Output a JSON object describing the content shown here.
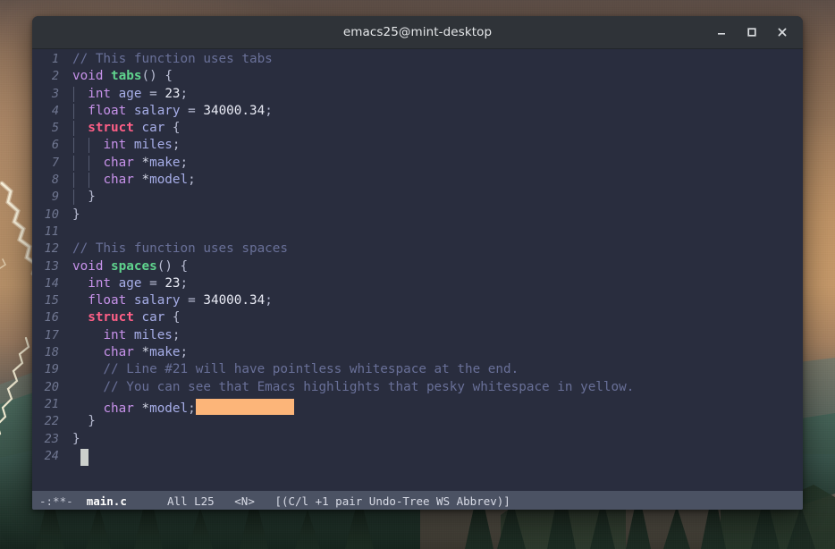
{
  "window": {
    "title": "emacs25@mint-desktop",
    "controls": [
      {
        "name": "minimize",
        "label": "Minimize",
        "glyph": "minimize-icon"
      },
      {
        "name": "maximize",
        "label": "Maximize",
        "glyph": "maximize-icon"
      },
      {
        "name": "close",
        "label": "Close",
        "glyph": "close-icon"
      }
    ]
  },
  "editor": {
    "buffer_name": "main.c",
    "cursor_line": 24,
    "cursor_column": 1,
    "lines": [
      {
        "n": 1,
        "text": "// This function uses tabs",
        "indent_guides": 0
      },
      {
        "n": 2,
        "text": "void tabs() {",
        "indent_guides": 0
      },
      {
        "n": 3,
        "text": "\tint age = 23;",
        "indent_guides": 1
      },
      {
        "n": 4,
        "text": "\tfloat salary = 34000.34;",
        "indent_guides": 1
      },
      {
        "n": 5,
        "text": "\tstruct car {",
        "indent_guides": 1
      },
      {
        "n": 6,
        "text": "\t\tint miles;",
        "indent_guides": 2
      },
      {
        "n": 7,
        "text": "\t\tchar *make;",
        "indent_guides": 2
      },
      {
        "n": 8,
        "text": "\t\tchar *model;",
        "indent_guides": 2
      },
      {
        "n": 9,
        "text": "\t}",
        "indent_guides": 1
      },
      {
        "n": 10,
        "text": "}",
        "indent_guides": 0
      },
      {
        "n": 11,
        "text": "",
        "indent_guides": 0
      },
      {
        "n": 12,
        "text": "// This function uses spaces",
        "indent_guides": 0
      },
      {
        "n": 13,
        "text": "void spaces() {",
        "indent_guides": 0
      },
      {
        "n": 14,
        "text": "  int age = 23;",
        "indent_guides": 0
      },
      {
        "n": 15,
        "text": "  float salary = 34000.34;",
        "indent_guides": 0
      },
      {
        "n": 16,
        "text": "  struct car {",
        "indent_guides": 0
      },
      {
        "n": 17,
        "text": "    int miles;",
        "indent_guides": 0
      },
      {
        "n": 18,
        "text": "    char *make;",
        "indent_guides": 0
      },
      {
        "n": 19,
        "text": "    // Line #21 will have pointless whitespace at the end.",
        "indent_guides": 0
      },
      {
        "n": 20,
        "text": "    // You can see that Emacs highlights that pesky whitespace in yellow.",
        "indent_guides": 0
      },
      {
        "n": 21,
        "text": "    char *model;        ",
        "indent_guides": 0,
        "trailing_whitespace": true
      },
      {
        "n": 22,
        "text": "  }",
        "indent_guides": 0
      },
      {
        "n": 23,
        "text": "}",
        "indent_guides": 0
      },
      {
        "n": 24,
        "text": " ",
        "indent_guides": 0,
        "has_cursor": true
      }
    ]
  },
  "modeline": {
    "flags": "-:**-",
    "buffer": "main.c",
    "position_all": "All",
    "position_line": "L25",
    "input_method": "<N>",
    "minor_modes": "[(C/l +1 pair Undo-Tree WS Abbrev)]",
    "full_text": "-:**-  main.c      All L25   <N>   [(C/l +1 pair Undo-Tree WS Abbrev)]"
  },
  "colors": {
    "background": "#292d3e",
    "modeline_bg": "#4b5263",
    "comment": "#697098",
    "keyword": "#c792ea",
    "function": "#5fd38d",
    "struct": "#ff5f87",
    "variable": "#a7aee8",
    "whitespace_highlight": "#fcb579",
    "cursor": "#ccd0cc",
    "line_number": "#6f7690",
    "titlebar_bg": "#2f3338"
  }
}
